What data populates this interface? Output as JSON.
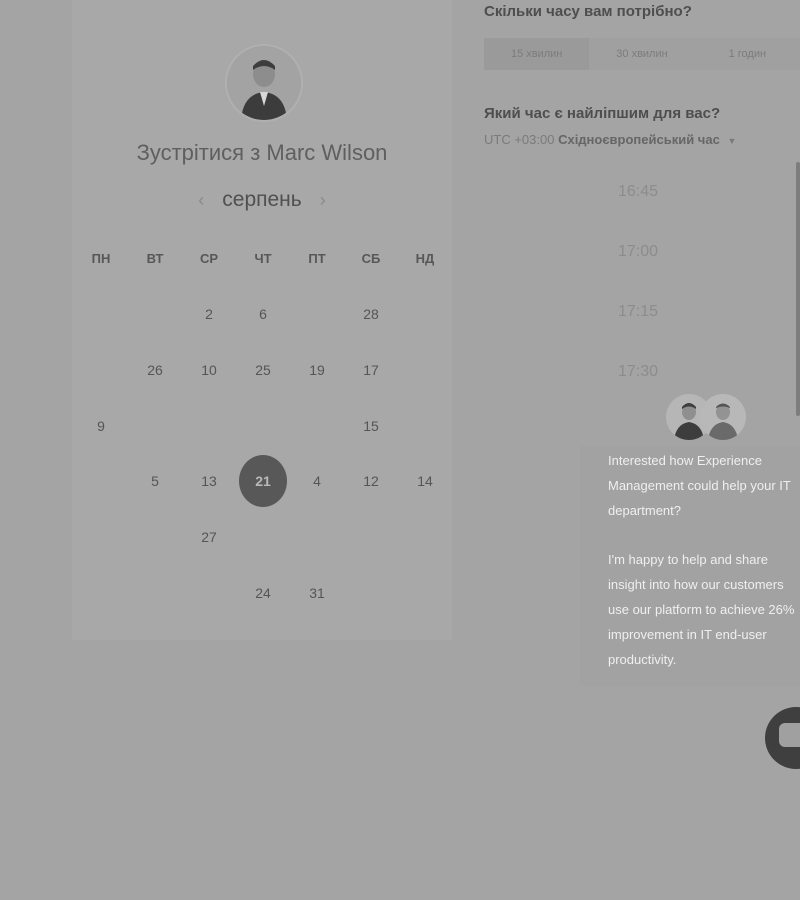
{
  "host": {
    "title_prefix": "Зустрітися з",
    "name": "Marc Wilson"
  },
  "calendar": {
    "month": "серпень",
    "prev_icon": "‹",
    "next_icon": "›",
    "weekdays": [
      "ПН",
      "ВТ",
      "СР",
      "ЧТ",
      "ПТ",
      "СБ",
      "НД"
    ],
    "weeks": [
      [
        "",
        "",
        "2",
        "6",
        "",
        "28",
        ""
      ],
      [
        "",
        "26",
        "10",
        "25",
        "19",
        "17",
        ""
      ],
      [
        "9",
        "",
        "",
        "",
        "",
        "15",
        ""
      ],
      [
        "",
        "5",
        "13",
        "21",
        "4",
        "12",
        "14"
      ],
      [
        "",
        "",
        "27",
        "",
        "",
        "",
        ""
      ],
      [
        "",
        "",
        "",
        "24",
        "31",
        "",
        ""
      ]
    ],
    "selected_day": "21"
  },
  "duration": {
    "question": "Скільки часу вам потрібно?",
    "options": [
      "15 хвилин",
      "30 хвилин",
      "1 годин"
    ],
    "active_index": 0
  },
  "time": {
    "question": "Який час є найліпшим для вас?",
    "tz_offset": "UTC +03:00",
    "tz_name": "Східноєвропейський час",
    "slots": [
      "16:45",
      "17:00",
      "17:15",
      "17:30"
    ]
  },
  "chat": {
    "message_1": "Interested how Experience Management could help your IT department?",
    "message_2": "I'm happy to help and share insight into how our customers use our platform to achieve 26% improvement in IT end-user productivity."
  },
  "icons": {
    "launcher": "chat-icon",
    "tz_dropdown": "caret-down-icon"
  }
}
